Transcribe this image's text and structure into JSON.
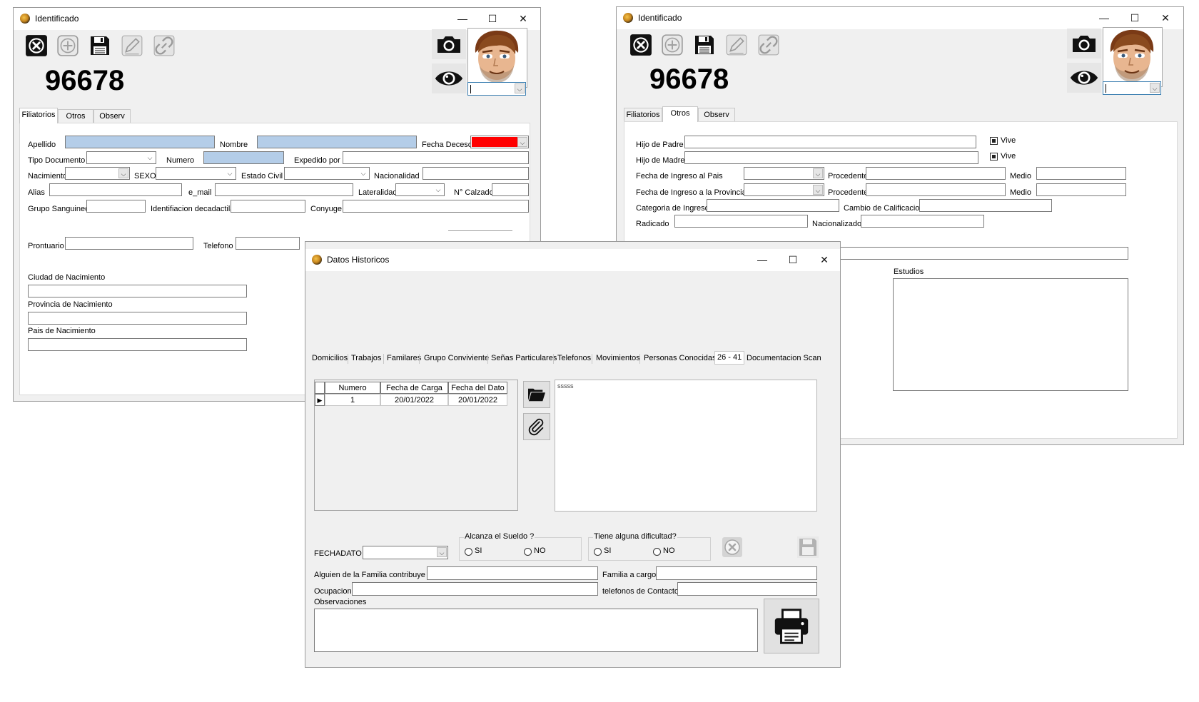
{
  "window_left": {
    "title": "Identificado",
    "record_id": "96678",
    "tabs": [
      "Filiatorios",
      "Otros",
      "Observ"
    ],
    "labels": {
      "apellido": "Apellido",
      "nombre": "Nombre",
      "fecha_deceso": "Fecha Deceso",
      "tipo_documento": "Tipo Documento",
      "numero": "Numero",
      "expedido_por": "Expedido por",
      "nacimiento": "Nacimiento",
      "sexo": "SEXO",
      "estado_civil": "Estado Civil",
      "nacionalidad": "Nacionalidad",
      "alias": "Alias",
      "email": "e_mail",
      "lateralidad": "Lateralidad",
      "calzado": "N° Calzado",
      "grupo_sanguineo": "Grupo Sanguineo",
      "identificacion_decadactilar": "Identifiacion decadactilar",
      "conyuge": "Conyuge",
      "prontuario": "Prontuario",
      "telefono": "Telefono",
      "ciudad_nac": "Ciudad de Nacimiento",
      "provincia_nac": "Provincia de Nacimiento",
      "pais_nac": "Pais de Nacimiento"
    }
  },
  "window_right": {
    "title": "Identificado",
    "record_id": "96678",
    "tabs": [
      "Filiatorios",
      "Otros",
      "Observ"
    ],
    "labels": {
      "hijo_padre": "Hijo de Padre",
      "hijo_madre": "Hijo de Madre",
      "vive1": "Vive",
      "vive2": "Vive",
      "ingreso_pais": "Fecha de Ingreso al Pais",
      "procedente1": "Procedente",
      "medio1": "Medio",
      "ingreso_provincia": "Fecha de Ingreso a la Provincia",
      "procedente2": "Procedente",
      "medio2": "Medio",
      "categoria_ingreso": "Categoria de Ingreso",
      "cambio_calificacion": "Cambio de Calificacion",
      "radicado": "Radicado",
      "nacionalizado": "Nacionalizado",
      "estudios": "Estudios"
    }
  },
  "window_hist": {
    "title": "Datos Historicos",
    "tabs": [
      "Domicilios",
      "Trabajos",
      "Familares",
      "Grupo Conviviente",
      "Señas Particulares",
      "Telefonos",
      "Movimientos",
      "Personas Conocidas",
      "26 - 41",
      "Documentacion Scan"
    ],
    "grid": {
      "columns": [
        "Numero Informe",
        "Fecha de Carga",
        "Fecha del Dato"
      ],
      "rows": [
        [
          "1",
          "20/01/2022",
          "20/01/2022"
        ]
      ]
    },
    "memo_text": "sssss",
    "labels": {
      "fechadato": "FECHADATO",
      "alcanza": "Alcanza el Sueldo ?",
      "si1": "SI",
      "no1": "NO",
      "dificultad": "Tiene alguna dificultad?",
      "si2": "SI",
      "no2": "NO",
      "contribuye": "Alguien de la Familia contribuye ?",
      "familia_cargo": "Familia a cargo",
      "ocupacion": "Ocupacion",
      "telefonos_contacto": "telefonos de Contacto",
      "observaciones": "Observaciones"
    }
  },
  "colors": {
    "red_field": "#ff0000",
    "blue_field": "#b4cde8",
    "window_bg": "#f0f0f0"
  },
  "icons": [
    "close-record-icon",
    "add-icon",
    "save-icon",
    "edit-icon",
    "link-icon",
    "camera-icon",
    "eye-icon",
    "folder-open-icon",
    "paperclip-icon",
    "cancel-icon",
    "printer-icon"
  ]
}
